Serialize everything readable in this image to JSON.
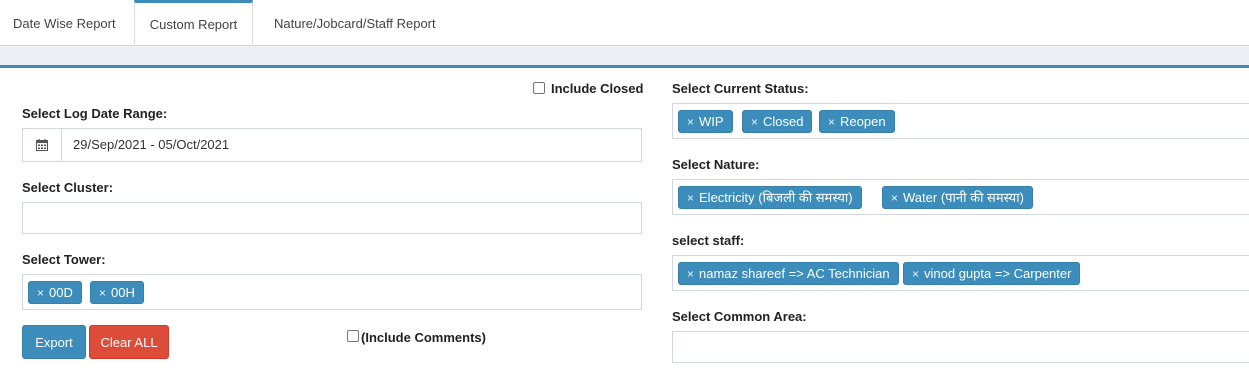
{
  "tabs": [
    "Date Wise Report",
    "Custom Report",
    "Nature/Jobcard/Staff Report"
  ],
  "left": {
    "include_closed_label": "Include Closed",
    "log_date_label": "Select Log Date Range:",
    "log_date_value": "29/Sep/2021 - 05/Oct/2021",
    "cluster_label": "Select Cluster:",
    "tower_label": "Select Tower:",
    "tower_chips": [
      "00D",
      "00H"
    ],
    "export_label": "Export",
    "clear_label": "Clear ALL",
    "include_comments_label": "(Include Comments)"
  },
  "right": {
    "status_label": "Select Current Status:",
    "status_chips": [
      "WIP",
      "Closed",
      "Reopen"
    ],
    "nature_label": "Select Nature:",
    "nature_chips": [
      "Electricity (बिजली की समस्या)",
      "Water (पानी की समस्या)"
    ],
    "staff_label": "select staff:",
    "staff_chips": [
      "namaz shareef => AC Technician",
      "vinod gupta => Carpenter"
    ],
    "common_area_label": "Select Common Area:"
  },
  "icons": {
    "calendar": "calendar-icon",
    "remove": "×"
  },
  "colors": {
    "primary": "#3c8dbc",
    "danger": "#dd4b39",
    "chip": "#3c8dbc"
  }
}
